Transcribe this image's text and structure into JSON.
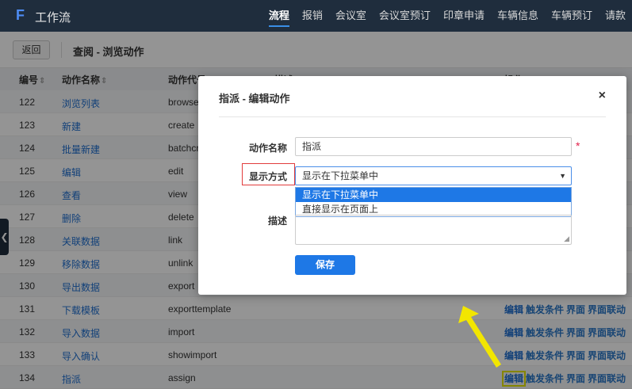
{
  "app": {
    "logo": "F",
    "title": "工作流"
  },
  "nav": [
    "流程",
    "报销",
    "会议室",
    "会议室预订",
    "印章申请",
    "车辆信息",
    "车辆预订",
    "请款"
  ],
  "toolbar": {
    "back_label": "返回",
    "title": "查阅 - 浏览动作"
  },
  "table": {
    "headers": {
      "id": "编号",
      "name": "动作名称",
      "code": "动作代号",
      "desc": "描述",
      "ops": "操作"
    },
    "rows": [
      {
        "id": "122",
        "name": "浏览列表",
        "code": "browse"
      },
      {
        "id": "123",
        "name": "新建",
        "code": "create"
      },
      {
        "id": "124",
        "name": "批量新建",
        "code": "batchcr"
      },
      {
        "id": "125",
        "name": "编辑",
        "code": "edit"
      },
      {
        "id": "126",
        "name": "查看",
        "code": "view"
      },
      {
        "id": "127",
        "name": "删除",
        "code": "delete"
      },
      {
        "id": "128",
        "name": "关联数据",
        "code": "link"
      },
      {
        "id": "129",
        "name": "移除数据",
        "code": "unlink"
      },
      {
        "id": "130",
        "name": "导出数据",
        "code": "export"
      },
      {
        "id": "131",
        "name": "下载模板",
        "code": "exporttemplate"
      },
      {
        "id": "132",
        "name": "导入数据",
        "code": "import"
      },
      {
        "id": "133",
        "name": "导入确认",
        "code": "showimport"
      },
      {
        "id": "134",
        "name": "指派",
        "code": "assign"
      }
    ],
    "ops": {
      "edit": "编辑",
      "trigger": "触发条件",
      "ui": "界面",
      "ui_link": "界面联动"
    }
  },
  "modal": {
    "title": "指派 - 编辑动作",
    "close": "×",
    "name_label": "动作名称",
    "name_value": "指派",
    "required_mark": "*",
    "display_label": "显示方式",
    "display_value": "显示在下拉菜单中",
    "display_arrow": "▼",
    "options": [
      "显示在下拉菜单中",
      "直接显示在页面上"
    ],
    "desc_label": "描述",
    "save_label": "保存"
  },
  "colors": {
    "nav_bg": "#1f2d3d",
    "primary": "#1e78e6",
    "link": "#1f6fd0",
    "highlight": "#e5e500",
    "error": "#e23c3c"
  }
}
